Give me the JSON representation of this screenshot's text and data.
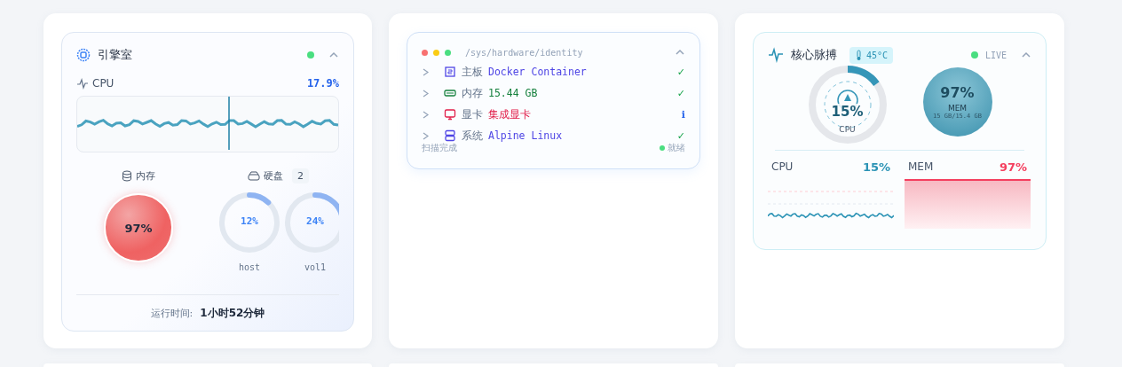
{
  "engine": {
    "title": "引擎室",
    "online": true,
    "expanded": true,
    "cpu": {
      "label": "CPU",
      "reading": "17.9%"
    },
    "memory": {
      "label": "内存",
      "reading": "97%"
    },
    "disk": {
      "label": "硬盘",
      "count": "2",
      "volumes": [
        {
          "name": "host",
          "reading": "12%"
        },
        {
          "name": "vol1",
          "reading": "24%"
        }
      ]
    },
    "uptime": {
      "label": "运行时间:",
      "value": "1小时52分钟"
    }
  },
  "hardware": {
    "path": "/sys/hardware/identity",
    "expanded": true,
    "rows": [
      {
        "kind": "board",
        "label": "主板",
        "value": "Docker Container",
        "color": "#4f46e5",
        "status": "✓",
        "verified": true
      },
      {
        "kind": "memory",
        "label": "内存",
        "value": "15.44 GB",
        "color": "#15803d",
        "status": "✓",
        "verified": true
      },
      {
        "kind": "display",
        "label": "显卡",
        "value": "集成显卡",
        "color": "#e11d48",
        "status": "ℹ",
        "verified": false
      },
      {
        "kind": "system",
        "label": "系统",
        "value": "Alpine Linux",
        "color": "#4f46e5",
        "status": "✓",
        "verified": true
      }
    ],
    "footer": "扫描完成",
    "ready": true,
    "status": "就绪"
  },
  "pulse": {
    "title": "核心脉搏",
    "temperature": "45°C",
    "online": true,
    "live": "LIVE",
    "expanded": true,
    "cpu": {
      "reading": "15%",
      "label": "CPU"
    },
    "mem": {
      "reading": "97%",
      "label": "MEM",
      "detail": "15 GB/15.4 GB"
    },
    "charts": [
      {
        "kind": "cpu",
        "label": "CPU",
        "reading": "15%"
      },
      {
        "kind": "mem",
        "label": "MEM",
        "reading": "97%"
      }
    ]
  }
}
